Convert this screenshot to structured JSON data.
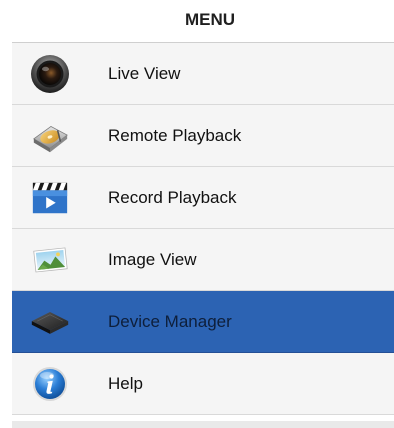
{
  "header": {
    "title": "MENU"
  },
  "menu": {
    "items": [
      {
        "label": "Live View",
        "icon": "camera-lens-icon",
        "selected": false
      },
      {
        "label": "Remote Playback",
        "icon": "hard-drive-icon",
        "selected": false
      },
      {
        "label": "Record Playback",
        "icon": "clapperboard-icon",
        "selected": false
      },
      {
        "label": "Image View",
        "icon": "image-icon",
        "selected": false
      },
      {
        "label": "Device Manager",
        "icon": "dvr-box-icon",
        "selected": true
      },
      {
        "label": "Help",
        "icon": "info-icon",
        "selected": false
      }
    ]
  },
  "colors": {
    "selected_background": "#2c63b3",
    "item_background": "#f5f5f5",
    "separator": "#d9d9d9",
    "text": "#111111"
  }
}
